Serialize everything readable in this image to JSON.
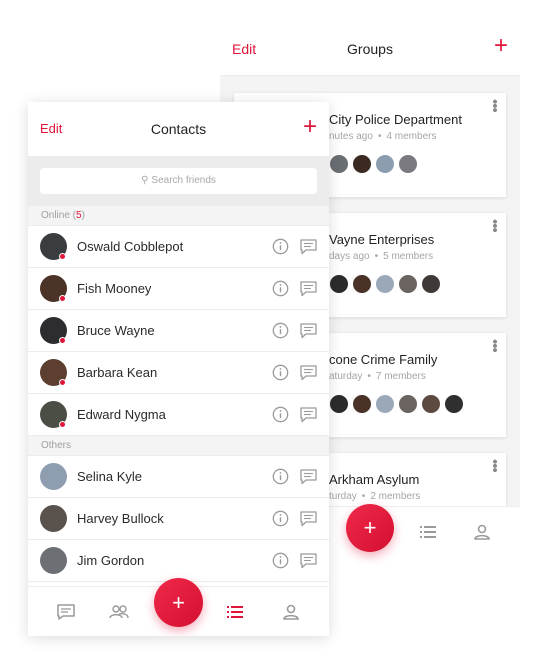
{
  "colors": {
    "accent": "#e0153a",
    "muted": "#9f9f9f",
    "background": "#f4f4f4"
  },
  "groups": {
    "edit_label": "Edit",
    "title": "Groups",
    "add_label": "+",
    "cards": [
      {
        "name": "City Police Department",
        "time": "nutes ago",
        "members": "4 members",
        "avatars": [
          "#6a6f73",
          "#3b2a22",
          "#8c9db0",
          "#7a7a80"
        ]
      },
      {
        "name": "Vayne Enterprises",
        "time": "days ago",
        "members": "5 members",
        "avatars": [
          "#2c2c2c",
          "#4a3326",
          "#9aa8b8",
          "#6b6461",
          "#3f3a38"
        ]
      },
      {
        "name": "cone Crime Family",
        "time": "aturday",
        "members": "7 members",
        "avatars": [
          "#2c2c2c",
          "#4a3326",
          "#9aa8b8",
          "#6b6461",
          "#5c4a40",
          "#2f2f30"
        ]
      },
      {
        "name": "Arkham Asylum",
        "time": "turday",
        "members": "2 members",
        "avatars": []
      }
    ],
    "fab_label": "+"
  },
  "contacts": {
    "edit_label": "Edit",
    "title": "Contacts",
    "add_label": "+",
    "search_placeholder": "Search friends",
    "online_label": "Online",
    "online_count": "5",
    "others_label": "Others",
    "online": [
      {
        "name": "Oswald Cobblepot",
        "avatar": "#3a3d40"
      },
      {
        "name": "Fish Mooney",
        "avatar": "#4b3328"
      },
      {
        "name": "Bruce Wayne",
        "avatar": "#2d2d2f"
      },
      {
        "name": "Barbara Kean",
        "avatar": "#5c3f2e"
      },
      {
        "name": "Edward Nygma",
        "avatar": "#4a4e44"
      }
    ],
    "others": [
      {
        "name": "Selina Kyle",
        "avatar": "#8f9db0"
      },
      {
        "name": "Harvey Bullock",
        "avatar": "#5a524c"
      },
      {
        "name": "Jim Gordon",
        "avatar": "#6c7074"
      }
    ],
    "fab_label": "+"
  }
}
